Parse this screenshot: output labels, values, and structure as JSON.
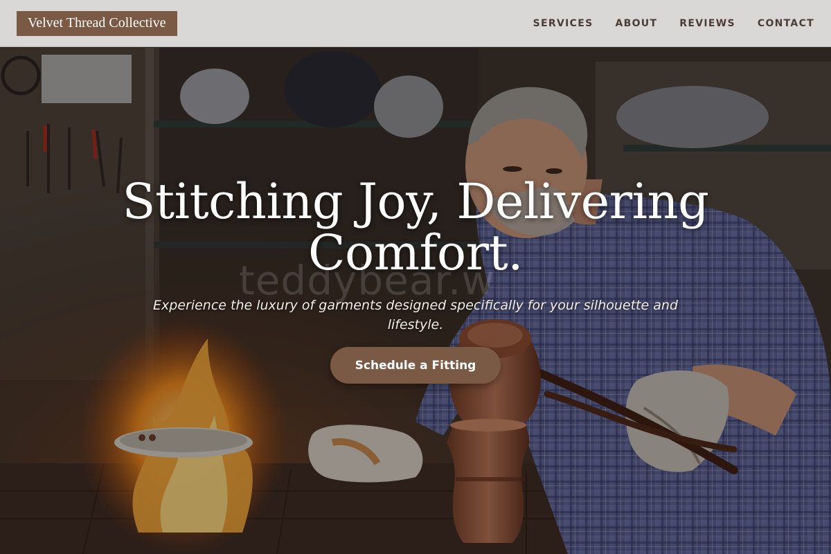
{
  "brand": {
    "name": "Velvet Thread Collective"
  },
  "nav": [
    {
      "label": "SERVICES"
    },
    {
      "label": "ABOUT"
    },
    {
      "label": "REVIEWS"
    },
    {
      "label": "CONTACT"
    }
  ],
  "hero": {
    "title_line1": "Stitching Joy, Delivering",
    "title_line2": "Comfort.",
    "subtitle": "Experience the luxury of garments designed specifically for your silhouette and lifestyle.",
    "cta_label": "Schedule a Fitting",
    "watermark": "teddybear.w"
  },
  "colors": {
    "header_bg": "#d9d8d7",
    "brand_bg": "#7a5a44",
    "nav_text": "#4a3d35",
    "cta_bg": "#7a5a44"
  }
}
